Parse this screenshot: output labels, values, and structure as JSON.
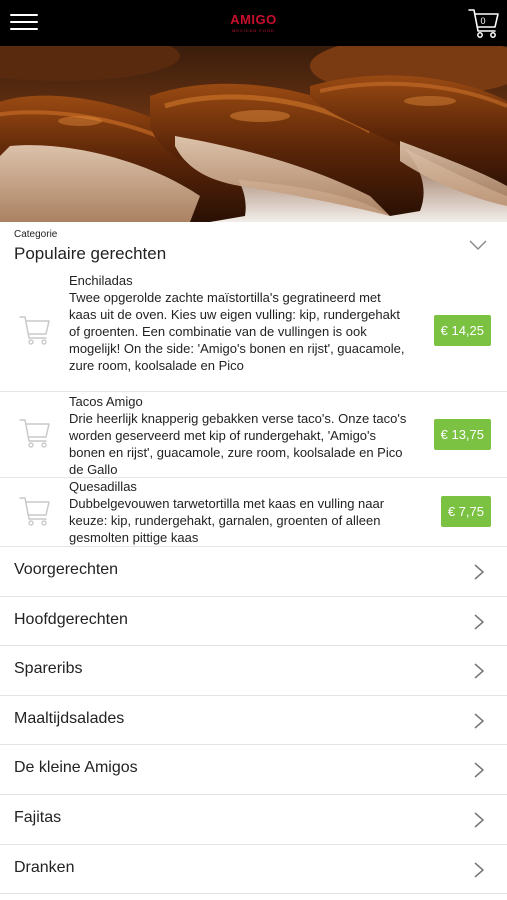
{
  "header": {
    "logo_text": "AMIGO",
    "logo_subtext": "MEXICAN FOOD",
    "cart_count": "0",
    "menu_icon": "hamburger-menu-icon",
    "cart_icon": "shopping-cart-icon"
  },
  "hero": {
    "image": "spare-ribs-photo"
  },
  "category": {
    "label": "Categorie",
    "title": "Populaire gerechten",
    "chevron_icon": "chevron-down-icon"
  },
  "dishes": [
    {
      "name": "Enchiladas",
      "description": "Twee opgerolde zachte maïstortilla's gegratineerd met kaas uit de oven. Kies uw eigen vulling: kip, rundergehakt of groenten. Een combinatie van de vullingen is ook mogelijk! On the side: 'Amigo's bonen en rijst', guacamole, zure room, koolsalade en Pico",
      "price": "€ 14,25"
    },
    {
      "name": "Tacos Amigo",
      "description": "Drie heerlijk knapperig gebakken verse taco's. Onze taco's worden geserveerd met kip of rundergehakt, 'Amigo's bonen en rijst', guacamole, zure room, koolsalade en Pico de Gallo",
      "price": "€ 13,75"
    },
    {
      "name": "Quesadillas",
      "description": "Dubbelgevouwen tarwetortilla met kaas en vulling naar keuze: kip, rundergehakt, garnalen, groenten of alleen gesmolten pittige kaas",
      "price": "€ 7,75"
    }
  ],
  "menu": [
    {
      "label": "Voorgerechten"
    },
    {
      "label": "Hoofdgerechten"
    },
    {
      "label": "Spareribs"
    },
    {
      "label": "Maaltijdsalades"
    },
    {
      "label": "De kleine Amigos"
    },
    {
      "label": "Fajitas"
    },
    {
      "label": "Dranken"
    }
  ],
  "colors": {
    "topbar": "#000000",
    "logo": "#c8102e",
    "price_bg": "#7cc242"
  }
}
